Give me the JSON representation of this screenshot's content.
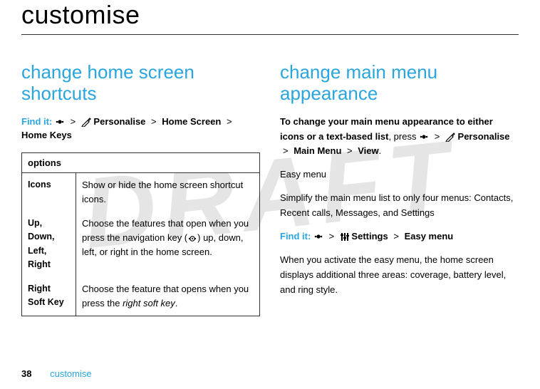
{
  "watermark": "DRAFT",
  "chapter_title": "customise",
  "left": {
    "heading": "change home screen shortcuts",
    "findit_label": "Find it:",
    "breadcrumb": {
      "item1": "Personalise",
      "item2": "Home Screen",
      "item3": "Home Keys"
    },
    "table": {
      "header": "options",
      "rows": [
        {
          "label": "Icons",
          "desc": "Show or hide the home screen shortcut icons."
        },
        {
          "label": "Up, Down, Left, Right",
          "desc_pre": "Choose the features that open when you press the navigation key (",
          "desc_post": ") up, down, left, or right in the home screen."
        },
        {
          "label": "Right Soft Key",
          "desc_pre": "Choose the feature that opens when you press the ",
          "desc_em": "right soft key",
          "desc_post": "."
        }
      ]
    }
  },
  "right": {
    "heading": "change main menu appearance",
    "intro_bold": "To change your main menu appearance to either icons or a text-based list",
    "intro_rest": ", press ",
    "breadcrumb1": {
      "item1": "Personalise",
      "item2": "Main Menu",
      "item3": "View"
    },
    "easy_title": "Easy menu",
    "easy_desc": "Simplify the main menu list to only four menus: Contacts, Recent calls, Messages, and Settings",
    "findit_label": "Find it:",
    "breadcrumb2": {
      "item1": "Settings",
      "item2": "Easy menu"
    },
    "closing": "When you activate the easy menu, the home screen displays additional three areas: coverage, battery level, and ring style."
  },
  "footer": {
    "page": "38",
    "label": "customise"
  },
  "glyphs": {
    "gt": ">"
  }
}
